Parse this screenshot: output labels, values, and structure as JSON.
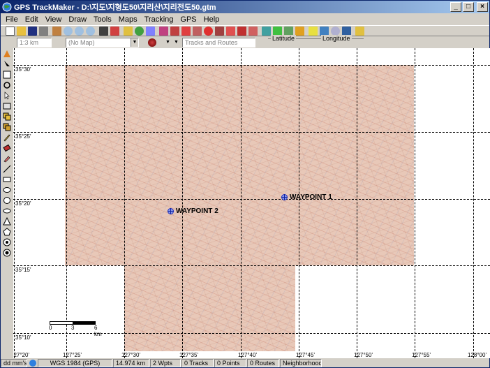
{
  "window": {
    "title": "GPS TrackMaker - D:\\지도\\지형도50\\지리산\\지리전도50.gtm",
    "controls": {
      "minimize": "_",
      "maximize": "□",
      "close": "×"
    }
  },
  "menu": [
    "File",
    "Edit",
    "View",
    "Draw",
    "Tools",
    "Maps",
    "Tracking",
    "GPS",
    "Help"
  ],
  "toolbar2": {
    "scale": "1:3 km",
    "map": "(No Map)",
    "tracks": "Tracks and Routes",
    "latitude_label": "Latitude",
    "longitude_label": "Longitude"
  },
  "map": {
    "latitudes": [
      "35°30'",
      "35°25'",
      "35°20'",
      "35°15'",
      "35°10'"
    ],
    "longitudes": [
      "127°20'",
      "127°25'",
      "127°30'",
      "127°35'",
      "127°40'",
      "127°45'",
      "127°50'",
      "127°55'",
      "128°00'"
    ],
    "waypoints": [
      {
        "name": "WAYPOINT 1"
      },
      {
        "name": "WAYPOINT 2"
      }
    ],
    "scale_labels": [
      "0",
      "3",
      "6 km"
    ]
  },
  "status": {
    "format": "dd mm'ss\"",
    "datum": "WGS 1984 (GPS)",
    "distance": "14.974 km",
    "waypoints": "2 Wpts",
    "tracks": "0 Tracks",
    "points": "0 Points",
    "routes": "0 Routes",
    "mode": "Neighborhood"
  },
  "colors": {
    "titlebar_start": "#0a246a",
    "titlebar_end": "#a6caf0",
    "map_tint": "#e8c8b8",
    "waypoint": "#2030c0"
  }
}
